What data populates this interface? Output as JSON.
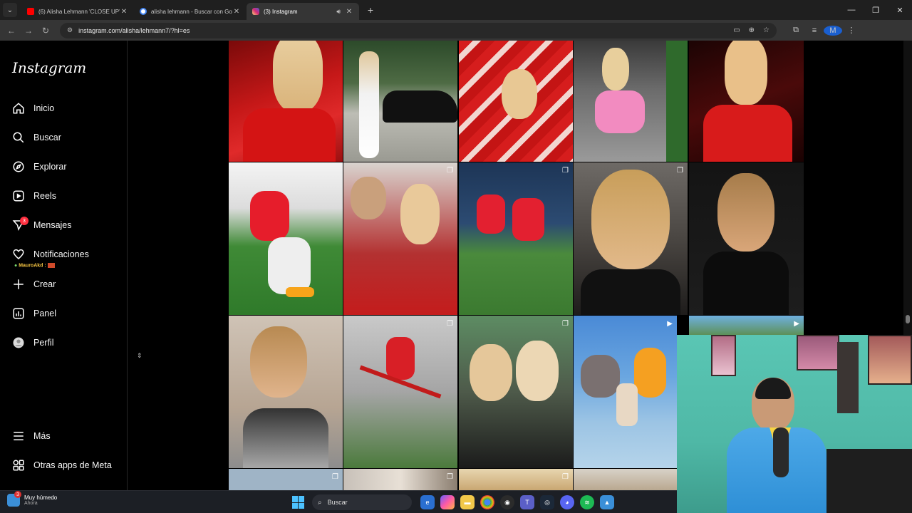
{
  "browser": {
    "tabs": [
      {
        "title": "(6) Alisha Lehmann 'CLOSE UP'",
        "favicon_color": "#ff0000",
        "active": false
      },
      {
        "title": "alisha lehmann - Buscar con Go",
        "favicon_color": "#4285f4",
        "active": false
      },
      {
        "title": "(3) Instagram",
        "favicon_color": "#e1306c",
        "active": true
      }
    ],
    "url": "instagram.com/alisha/lehmann7/?hl=es",
    "profile_initial": "M"
  },
  "instagram": {
    "logo": "Instagram",
    "nav": [
      {
        "label": "Inicio",
        "icon": "home-icon"
      },
      {
        "label": "Buscar",
        "icon": "search-icon"
      },
      {
        "label": "Explorar",
        "icon": "compass-icon"
      },
      {
        "label": "Reels",
        "icon": "reels-icon"
      },
      {
        "label": "Mensajes",
        "icon": "messenger-icon",
        "badge": "3"
      },
      {
        "label": "Notificaciones",
        "icon": "heart-icon"
      },
      {
        "label": "Crear",
        "icon": "plus-icon"
      },
      {
        "label": "Panel",
        "icon": "chart-icon"
      },
      {
        "label": "Perfil",
        "icon": "avatar-icon"
      },
      {
        "label": "Más",
        "icon": "menu-icon"
      },
      {
        "label": "Otras apps de Meta",
        "icon": "meta-apps-icon"
      }
    ],
    "notification_preview": "MauroAkd :",
    "grid": {
      "rows": [
        [
          "red-jersey-portrait",
          "car-white-outfit",
          "stadium-red-crowd",
          "car-pink-outfit",
          "red-jersey-smile"
        ],
        [
          "training-pitch-red",
          "selfie-with-fan",
          "warmup-pitch",
          "black-leather-portrait",
          "black-jacket-portrait"
        ],
        [
          "silver-top-portrait",
          "training-ladder",
          "selfie-two-friends",
          "street-art-dance",
          "outdoor-garden"
        ]
      ],
      "markers": {
        "row2": [
          "",
          "carousel-icon",
          "carousel-icon",
          "carousel-icon",
          ""
        ],
        "row3": [
          "",
          "carousel-icon",
          "carousel-icon",
          "reel-icon",
          "reel-icon"
        ]
      }
    }
  },
  "taskbar": {
    "weather_title": "Muy húmedo",
    "weather_sub": "Ahora",
    "weather_badge": "3",
    "search_placeholder": "Buscar"
  },
  "colors": {
    "accent_red": "#ff3040",
    "instagram_bg": "#000000"
  }
}
